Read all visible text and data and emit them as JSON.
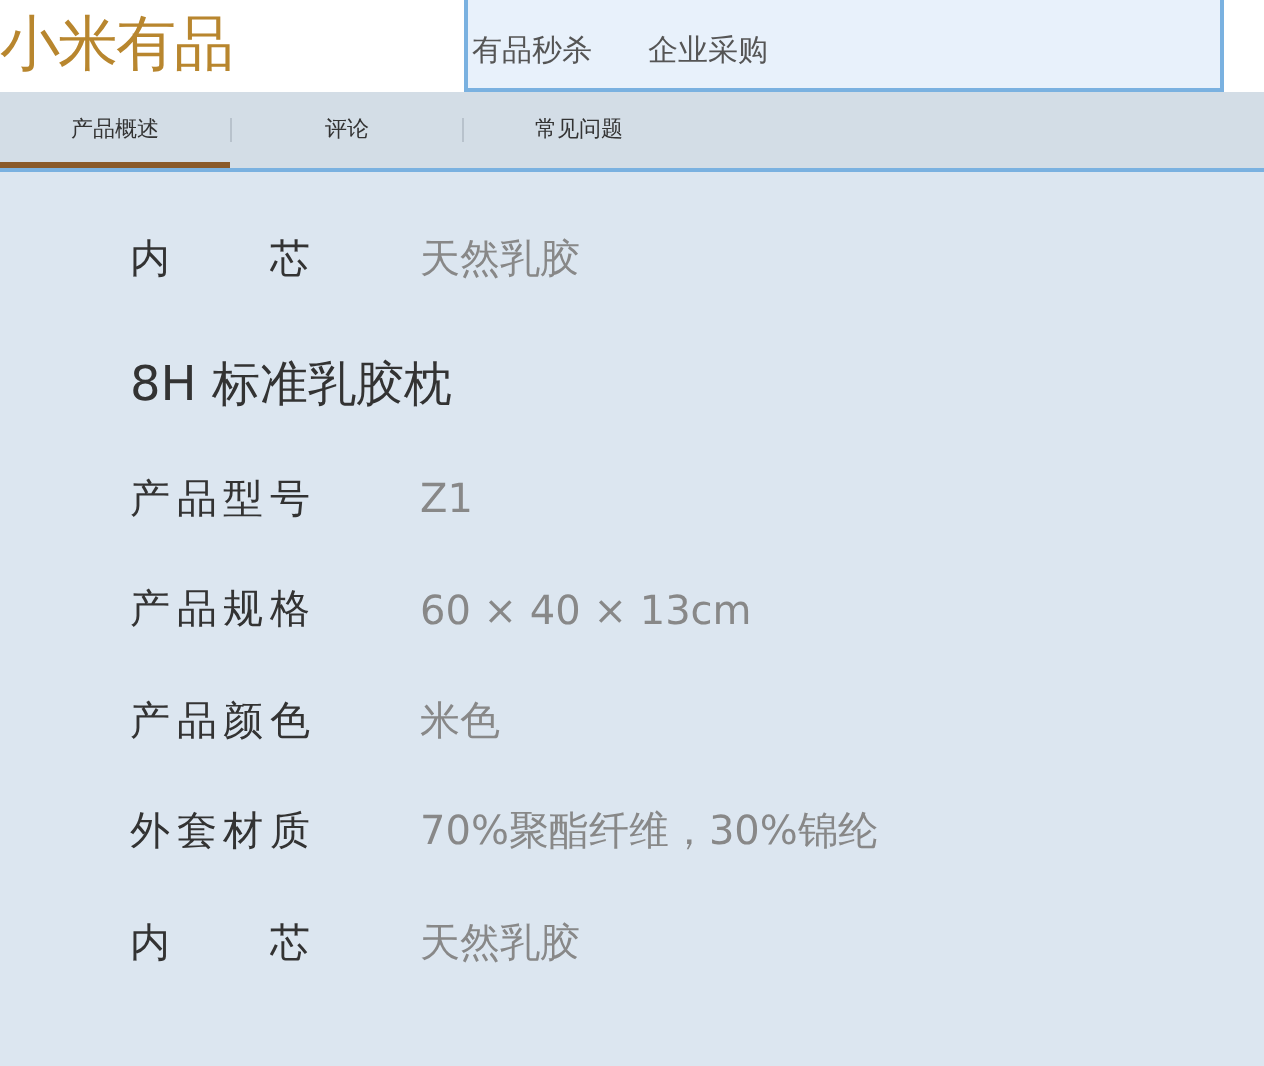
{
  "logo": "小米有品",
  "nav": [
    "有品秒杀",
    "企业采购"
  ],
  "tabs": [
    {
      "label": "产品概述",
      "selected": true
    },
    {
      "label": "评论",
      "selected": false
    },
    {
      "label": "常见问题",
      "selected": false
    }
  ],
  "sections": [
    {
      "rows": [
        {
          "label": "内 芯",
          "value": "天然乳胶"
        }
      ]
    },
    {
      "title": "8H 标准乳胶枕",
      "rows": [
        {
          "label": "产品型号",
          "value": "Z1"
        },
        {
          "label": "产品规格",
          "value": "60 × 40 × 13cm"
        },
        {
          "label": "产品颜色",
          "value": "米色"
        },
        {
          "label": "外套材质",
          "value": "70%聚酯纤维，30%锦纶"
        },
        {
          "label": "内 芯",
          "value": "天然乳胶"
        }
      ]
    }
  ]
}
